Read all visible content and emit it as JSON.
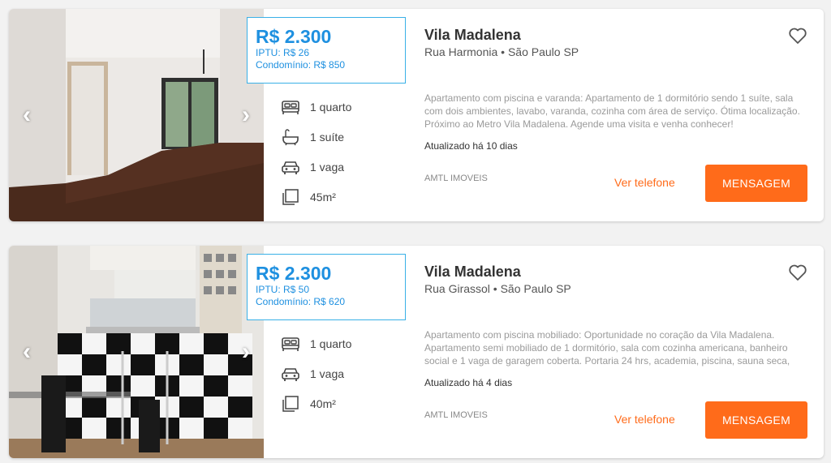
{
  "listings": [
    {
      "price": "R$ 2.300",
      "iptu": "IPTU: R$ 26",
      "condominio": "Condomínio: R$ 850",
      "title": "Vila Madalena",
      "address": "Rua Harmonia • São Paulo SP",
      "features": [
        {
          "icon": "bed-icon",
          "label": "1 quarto"
        },
        {
          "icon": "bathtub-icon",
          "label": "1 suíte"
        },
        {
          "icon": "car-icon",
          "label": "1 vaga"
        },
        {
          "icon": "area-icon",
          "label": "45m²"
        }
      ],
      "description": "Apartamento com piscina e varanda: Apartamento de 1 dormitório sendo 1 suíte, sala com dois ambientes, lavabo, varanda, cozinha com área de serviço. Ótima localização. Próximo ao Metro Vila Madalena. Agende uma visita e venha conhecer!",
      "updated": "Atualizado há 10 dias",
      "agency": "AMTL IMOVEIS",
      "phone_label": "Ver telefone",
      "message_label": "MENSAGEM"
    },
    {
      "price": "R$ 2.300",
      "iptu": "IPTU: R$ 50",
      "condominio": "Condomínio: R$ 620",
      "title": "Vila Madalena",
      "address": "Rua Girassol • São Paulo SP",
      "features": [
        {
          "icon": "bed-icon",
          "label": "1 quarto"
        },
        {
          "icon": "car-icon",
          "label": "1 vaga"
        },
        {
          "icon": "area-icon",
          "label": "40m²"
        }
      ],
      "description": "Apartamento com piscina mobiliado: Oportunidade no coração da Vila Madalena. Apartamento semi mobiliado de 1 dormitório, sala com cozinha americana, banheiro social e 1 vaga de garagem coberta. Portaria 24 hrs, academia, piscina, sauna seca,",
      "updated": "Atualizado há 4 dias",
      "agency": "AMTL IMOVEIS",
      "phone_label": "Ver telefone",
      "message_label": "MENSAGEM"
    }
  ],
  "colors": {
    "accent_orange": "#ff6b1a",
    "price_blue": "#1e90e0",
    "price_border": "#39b0e7"
  }
}
